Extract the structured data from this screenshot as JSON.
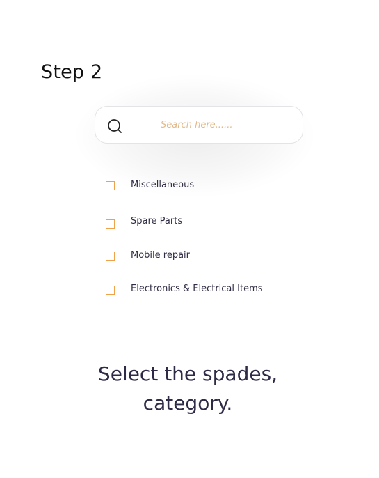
{
  "step": {
    "title": "Step 2"
  },
  "search": {
    "placeholder": "Search here......",
    "value": "",
    "icon": "search-icon"
  },
  "categories": [
    {
      "label": "Miscellaneous",
      "checked": false
    },
    {
      "label": "Spare Parts",
      "checked": false
    },
    {
      "label": "Mobile repair",
      "checked": false
    },
    {
      "label": "Electronics & Electrical Items",
      "checked": false
    }
  ],
  "caption": {
    "line1": "Select the spades,",
    "line2": "category."
  },
  "colors": {
    "accent": "#f0a24a",
    "placeholder": "#e3b98a",
    "text": "#2f2d44",
    "heading": "#111111"
  }
}
